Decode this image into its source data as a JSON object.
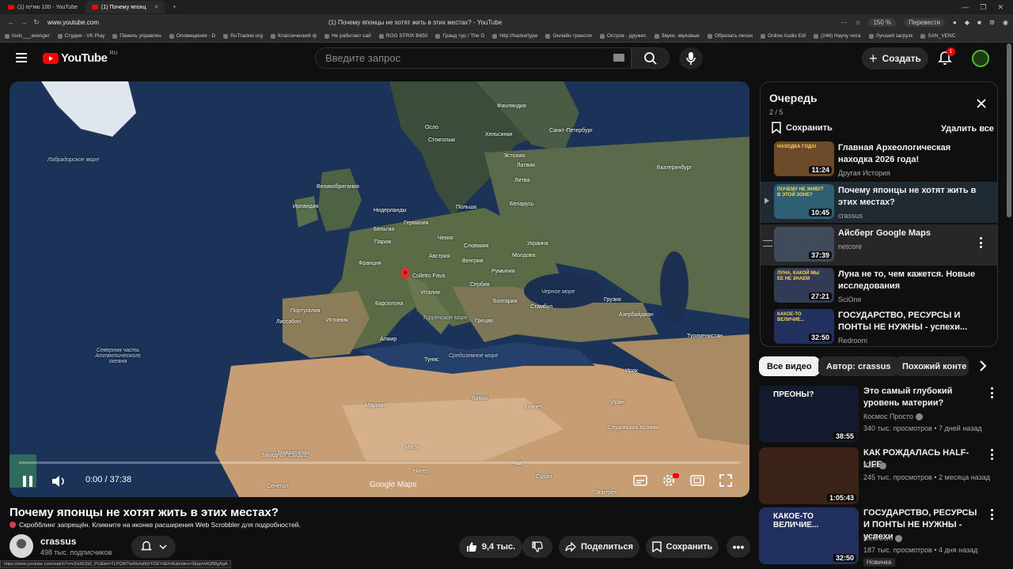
{
  "browser": {
    "tabs": [
      {
        "label": "(1) го*ню 100 - YouTube"
      },
      {
        "label": "(1) Почему японц"
      }
    ],
    "url": "www.youtube.com",
    "window_title": "(1) Почему японцы не хотят жить в этих местах? - YouTube",
    "zoom": "150 %",
    "translate": "Перевести",
    "bookmarks": [
      "toxic___avenger",
      "Студия - VK Play",
      "Панель управлен",
      "Оповещения - D",
      "RuTracker.org",
      "Классический ф",
      "Не работает сай",
      "ROG STRIX B650",
      "Гранд тур / The G",
      "http://hackertype",
      "Онлайн трансля",
      "Остров - дружес",
      "Звуки, звуковые",
      "Обрезать песни",
      "Online Audio Edi",
      "(246) Научу чита",
      "Лучший загрузк",
      "SAN_VENC"
    ]
  },
  "header": {
    "logo_text": "YouTube",
    "logo_region": "RU",
    "search_placeholder": "Введите запрос",
    "create_label": "Создать",
    "notif_count": "1"
  },
  "player": {
    "time": "0:00 / 37:38",
    "map_watermark": "Google Maps",
    "map_labels": [
      {
        "text": "Финляндия",
        "sea": false
      },
      {
        "text": "Осло",
        "sea": false
      },
      {
        "text": "Стокгольм",
        "sea": false
      },
      {
        "text": "Хельсинки",
        "sea": false
      },
      {
        "text": "Санкт-Петербург",
        "sea": false
      },
      {
        "text": "Эстония",
        "sea": false
      },
      {
        "text": "Латвия",
        "sea": false
      },
      {
        "text": "Литва",
        "sea": false
      },
      {
        "text": "Екатеринбург",
        "sea": false
      },
      {
        "text": "Великобритания",
        "sea": false
      },
      {
        "text": "Ирландия",
        "sea": false
      },
      {
        "text": "Нидерланды",
        "sea": false
      },
      {
        "text": "Польша",
        "sea": false
      },
      {
        "text": "Беларусь",
        "sea": false
      },
      {
        "text": "Германия",
        "sea": false
      },
      {
        "text": "Бельгия",
        "sea": false
      },
      {
        "text": "Чехия",
        "sea": false
      },
      {
        "text": "Словакия",
        "sea": false
      },
      {
        "text": "Украина",
        "sea": false
      },
      {
        "text": "Париж",
        "sea": false
      },
      {
        "text": "Франция",
        "sea": false
      },
      {
        "text": "Австрия",
        "sea": false
      },
      {
        "text": "Венгрия",
        "sea": false
      },
      {
        "text": "Молдова",
        "sea": false
      },
      {
        "text": "Colletto Fava",
        "sea": false
      },
      {
        "text": "Румыния",
        "sea": false
      },
      {
        "text": "Сербия",
        "sea": false
      },
      {
        "text": "Италия",
        "sea": false
      },
      {
        "text": "Болгария",
        "sea": false
      },
      {
        "text": "Грузия",
        "sea": false
      },
      {
        "text": "Португалия",
        "sea": false
      },
      {
        "text": "Испания",
        "sea": false
      },
      {
        "text": "Барселона",
        "sea": false
      },
      {
        "text": "Стамбул",
        "sea": false
      },
      {
        "text": "Азербайджан",
        "sea": false
      },
      {
        "text": "Лиссабон",
        "sea": false
      },
      {
        "text": "Греция",
        "sea": false
      },
      {
        "text": "Туркменистан",
        "sea": false
      },
      {
        "text": "Тунис",
        "sea": false
      },
      {
        "text": "Алжир",
        "sea": false
      },
      {
        "text": "Марокко",
        "sea": false
      },
      {
        "text": "Ливия",
        "sea": false
      },
      {
        "text": "Египет",
        "sea": false
      },
      {
        "text": "Иран",
        "sea": false
      },
      {
        "text": "Ирак",
        "sea": false
      },
      {
        "text": "Западная Сахара",
        "sea": false
      },
      {
        "text": "Мали",
        "sea": false
      },
      {
        "text": "Нигер",
        "sea": false
      },
      {
        "text": "Чад",
        "sea": false
      },
      {
        "text": "Судан",
        "sea": false
      },
      {
        "text": "Мавритания",
        "sea": false
      },
      {
        "text": "Сенегал",
        "sea": false
      },
      {
        "text": "Саудовская Аравия",
        "sea": false
      },
      {
        "text": "Эритрея",
        "sea": false
      },
      {
        "text": "Лабрадорское море",
        "sea": true
      },
      {
        "text": "Северная часть Атлантического океана",
        "sea": true
      },
      {
        "text": "Черное море",
        "sea": true
      },
      {
        "text": "Тирренское море",
        "sea": true
      },
      {
        "text": "Средиземное море",
        "sea": true
      }
    ]
  },
  "video": {
    "title": "Почему японцы не хотят жить в этих местах?",
    "scrobble_note": "Скробблинг запрещён. Кликните на иконке расширения Web Scrobbler для подробностей.",
    "channel": "crassus",
    "subscribers": "498 тыс. подписчиков",
    "likes": "9,4 тыс.",
    "share": "Поделиться",
    "save": "Сохранить"
  },
  "status_url": "https://www.youtube.com/watch?v=cDeWJ0i2_PU&list=TLPQMTIwMzIwMjYFDEYdEfr4E&index=3&pp=iAQB8gAgA",
  "queue": {
    "title": "Очередь",
    "count": "2 / 5",
    "save_label": "Сохранить",
    "delete_label": "Удалить все",
    "items": [
      {
        "title": "Главная Археологическая находка 2026 года!",
        "channel": "Другая История",
        "duration": "11:24",
        "thumb_color": "#6b4a2a",
        "thumb_text": "НАХОДКА ГОДА!"
      },
      {
        "title": "Почему японцы не хотят жить в этих местах?",
        "channel": "crassus",
        "duration": "10:45",
        "thumb_color": "#2f5f73",
        "thumb_text": "ПОЧЕМУ НЕ ЖИВУТ В ЭТОЙ ЗОНЕ?"
      },
      {
        "title": "Айсберг Google Maps",
        "channel": "netcore",
        "duration": "37:39",
        "thumb_color": "#3f4a5a",
        "thumb_text": ""
      },
      {
        "title": "Луна не то, чем кажется. Новые исследования",
        "channel": "SciOne",
        "duration": "27:21",
        "thumb_color": "#323b55",
        "thumb_text": "ЛУНА, КАКОЙ МЫ ЕЕ НЕ ЗНАЕМ"
      },
      {
        "title": "ГОСУДАРСТВО, РЕСУРСЫ И ПОНТЫ НЕ НУЖНЫ - успехи...",
        "channel": "Redroom",
        "duration": "32:50",
        "thumb_color": "#22305f",
        "thumb_text": "КАКОЕ-ТО ВЕЛИЧИЕ..."
      }
    ]
  },
  "chips": [
    "Все видео",
    "Автор: crassus",
    "Похожий конте"
  ],
  "recommended": [
    {
      "title": "Это самый глубокий уровень материи?",
      "channel": "Космос Просто",
      "meta": "340 тыс. просмотров • 7 дней назад",
      "duration": "38:55",
      "thumb_color": "#141a2e",
      "thumb_text": "ПРЕОНЫ?",
      "badge": ""
    },
    {
      "title": "КАК РОЖДАЛАСЬ HALF-LIFE",
      "channel": "IGM",
      "meta": "245 тыс. просмотров • 2 месяца назад",
      "duration": "1:05:43",
      "thumb_color": "#3a2218",
      "thumb_text": "",
      "badge": ""
    },
    {
      "title": "ГОСУДАРСТВО, РЕСУРСЫ И ПОНТЫ НЕ НУЖНЫ - успехи ...",
      "channel": "Redroom",
      "meta": "187 тыс. просмотров • 4 дня назад",
      "duration": "32:50",
      "thumb_color": "#22305f",
      "thumb_text": "КАКОЕ-ТО ВЕЛИЧИЕ...",
      "badge": "Новинка"
    }
  ]
}
